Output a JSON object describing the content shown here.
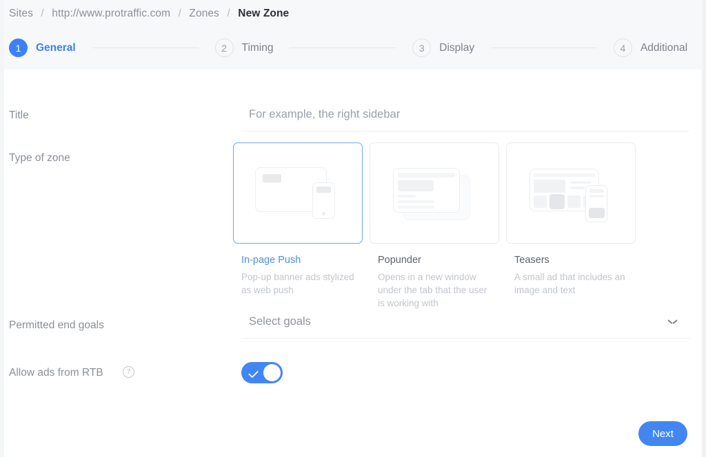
{
  "breadcrumb": {
    "items": [
      {
        "label": "Sites",
        "current": false
      },
      {
        "label": "http://www.protraffic.com",
        "current": false
      },
      {
        "label": "Zones",
        "current": false
      },
      {
        "label": "New Zone",
        "current": true
      }
    ],
    "separator": "/"
  },
  "stepper": {
    "steps": [
      {
        "number": "1",
        "label": "General",
        "state": "active"
      },
      {
        "number": "2",
        "label": "Timing",
        "state": "idle"
      },
      {
        "number": "3",
        "label": "Display",
        "state": "idle"
      },
      {
        "number": "4",
        "label": "Additional",
        "state": "idle"
      }
    ]
  },
  "form": {
    "title": {
      "label": "Title",
      "value": "",
      "placeholder": "For example, the right sidebar"
    },
    "type_of_zone": {
      "label": "Type of zone",
      "selected_index": 0,
      "options": [
        {
          "name": "In-page Push",
          "description": "Pop-up banner ads stylized as web push",
          "illustration": "desktop-and-phone-icon",
          "selected": true
        },
        {
          "name": "Popunder",
          "description": "Opens in a new window under the tab that the user is working with",
          "illustration": "stacked-windows-icon",
          "selected": false
        },
        {
          "name": "Teasers",
          "description": "A small ad that includes an image and text",
          "illustration": "grid-page-and-phone-icon",
          "selected": false
        }
      ]
    },
    "permitted_end_goals": {
      "label": "Permitted end goals",
      "value": "Select goals",
      "chevron": "chevron-down-icon"
    },
    "allow_rtb": {
      "label": "Allow ads from RTB",
      "help": "?",
      "enabled": true
    }
  },
  "footer": {
    "next_label": "Next"
  },
  "colors": {
    "accent": "#4286f2",
    "accent_text": "#3b82f6",
    "header_bg": "#f7f8f9",
    "muted_text": "#8a8f97",
    "placeholder_text": "#9aa0a8",
    "desc_text": "#c2c6cc",
    "border": "#e9ebee",
    "selected_border": "#6ea8f0"
  }
}
